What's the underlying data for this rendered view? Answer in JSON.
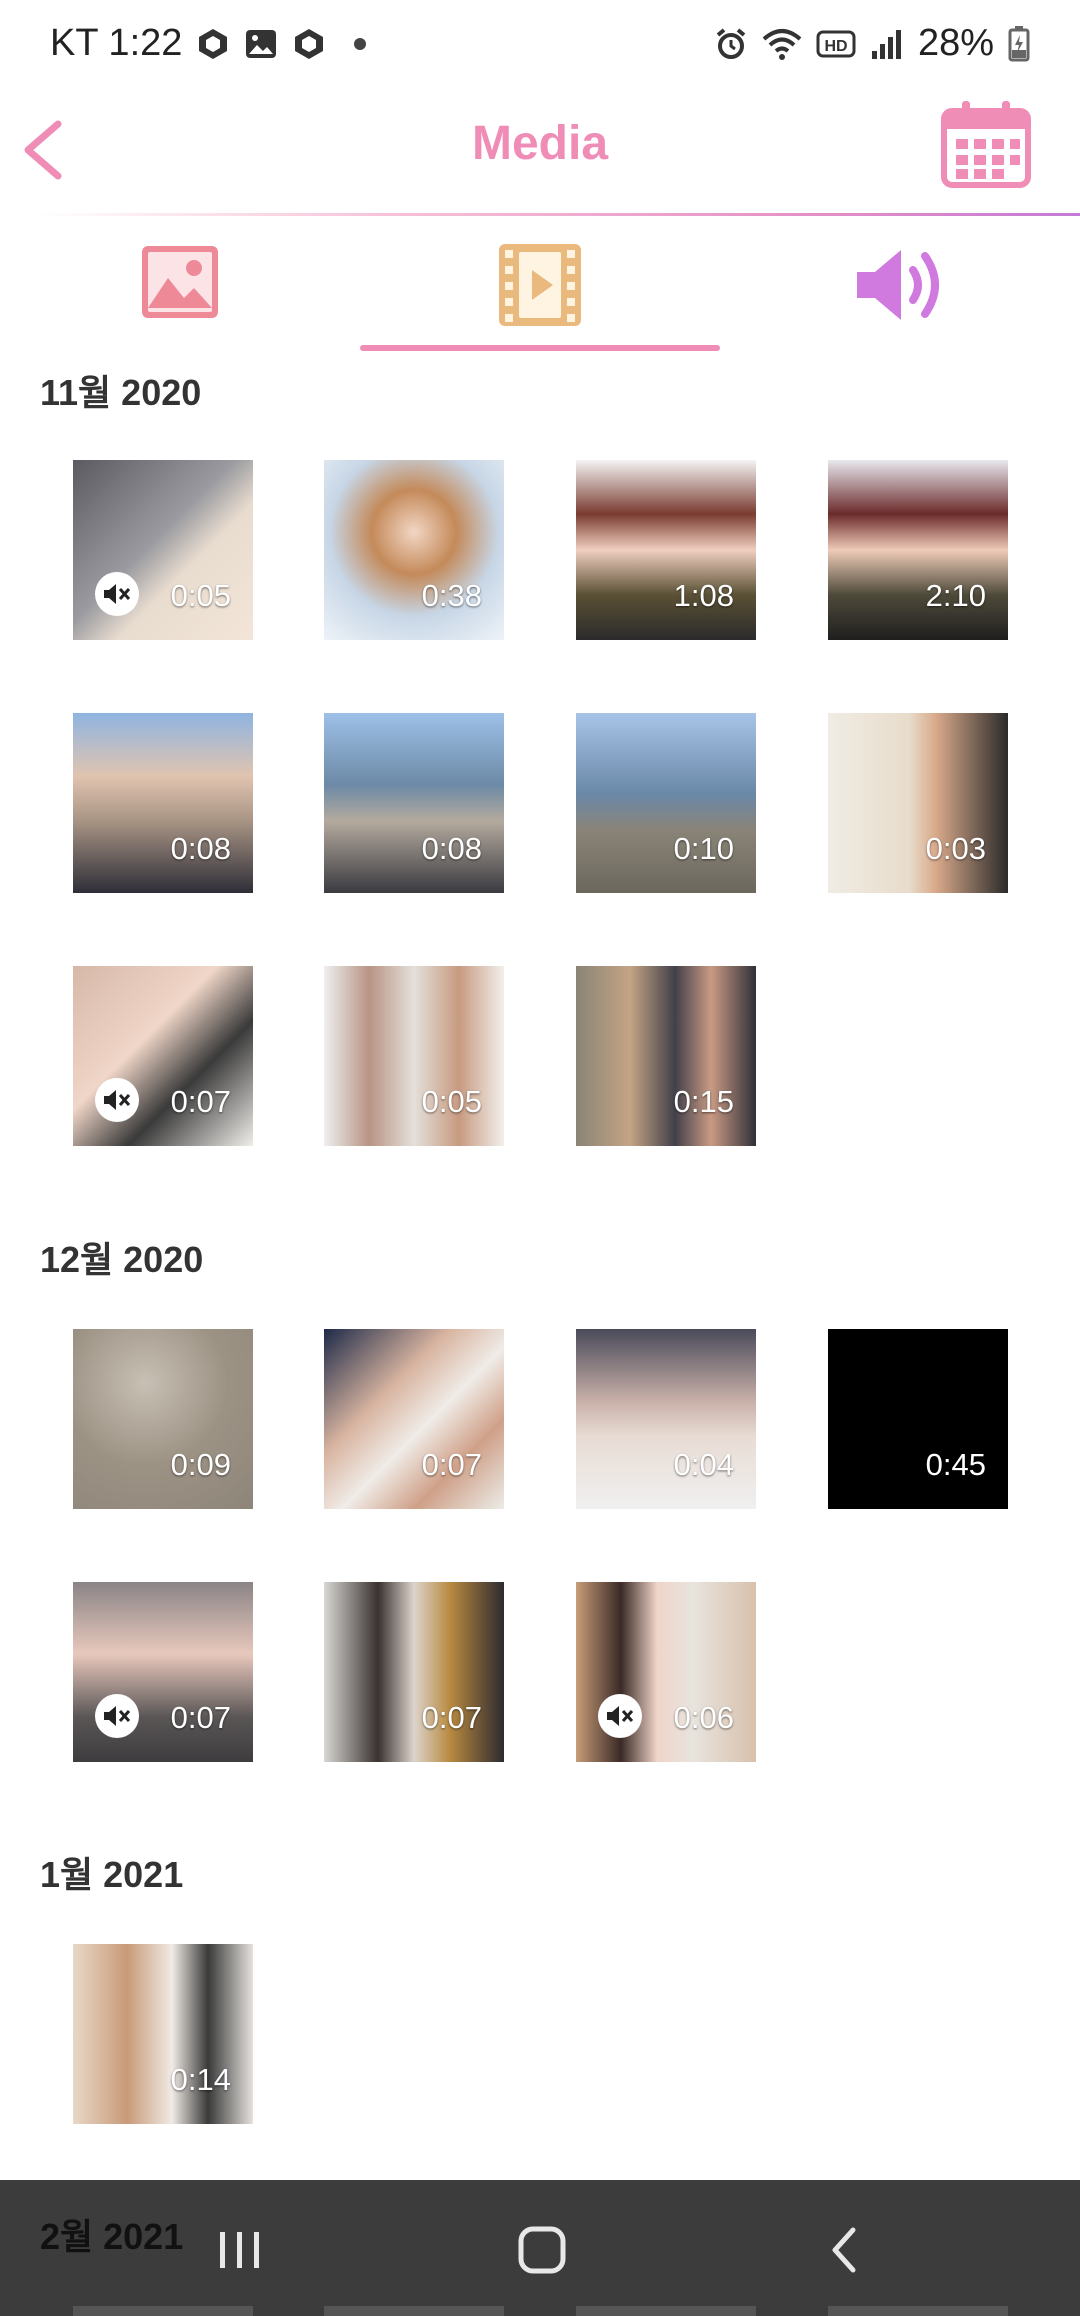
{
  "status_bar": {
    "carrier_time": "KT 1:22",
    "battery": "28%"
  },
  "app_bar": {
    "title": "Media"
  },
  "tabs": [
    {
      "name": "photos",
      "icon": "image-icon",
      "selected": false
    },
    {
      "name": "videos",
      "icon": "video-icon",
      "selected": true
    },
    {
      "name": "audio",
      "icon": "speaker-icon",
      "selected": false
    }
  ],
  "colors": {
    "accent_pink": "#ef8db7",
    "video_tab_orange": "#eab97e",
    "audio_purple": "#d07adf"
  },
  "sections": [
    {
      "title": "11월 2020",
      "items": [
        {
          "duration": "0:05",
          "muted": true
        },
        {
          "duration": "0:38",
          "muted": false
        },
        {
          "duration": "1:08",
          "muted": false
        },
        {
          "duration": "2:10",
          "muted": false
        },
        {
          "duration": "0:08",
          "muted": false
        },
        {
          "duration": "0:08",
          "muted": false
        },
        {
          "duration": "0:10",
          "muted": false
        },
        {
          "duration": "0:03",
          "muted": false
        },
        {
          "duration": "0:07",
          "muted": true
        },
        {
          "duration": "0:05",
          "muted": false
        },
        {
          "duration": "0:15",
          "muted": false
        }
      ]
    },
    {
      "title": "12월 2020",
      "items": [
        {
          "duration": "0:09",
          "muted": false
        },
        {
          "duration": "0:07",
          "muted": false
        },
        {
          "duration": "0:04",
          "muted": false
        },
        {
          "duration": "0:45",
          "muted": false
        },
        {
          "duration": "0:07",
          "muted": true
        },
        {
          "duration": "0:07",
          "muted": false
        },
        {
          "duration": "0:06",
          "muted": true
        }
      ]
    },
    {
      "title": "1월 2021",
      "items": [
        {
          "duration": "0:14",
          "muted": false
        }
      ]
    }
  ],
  "peek_section": {
    "title": "2월 2021"
  }
}
